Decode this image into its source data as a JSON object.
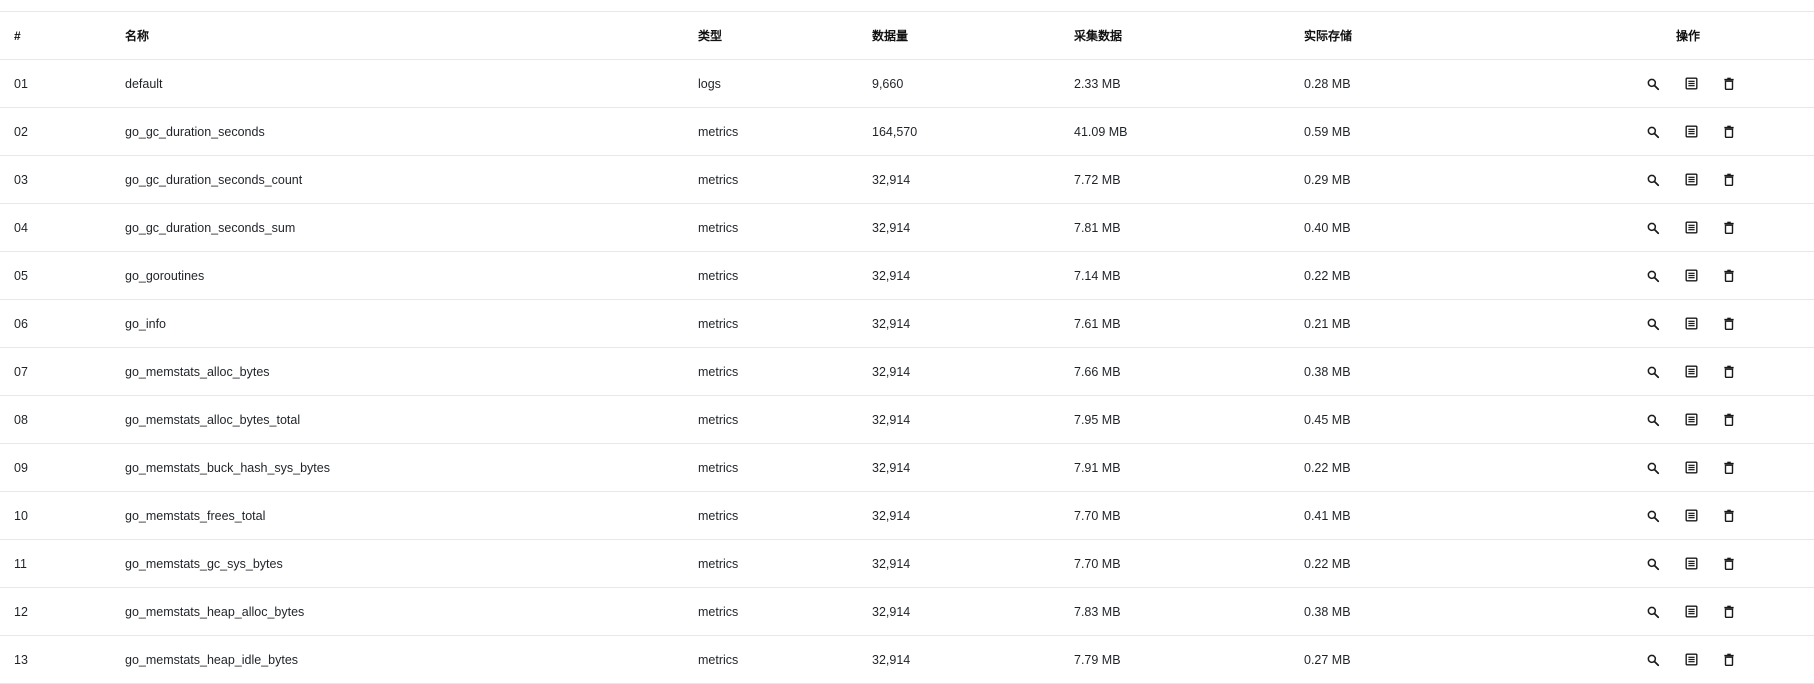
{
  "table": {
    "columns": {
      "index": "#",
      "name": "名称",
      "type": "类型",
      "count": "数据量",
      "collected": "采集数据",
      "storage": "实际存储",
      "actions": "操作"
    },
    "rows": [
      {
        "index": "01",
        "name": "default",
        "type": "logs",
        "count": "9,660",
        "collected": "2.33 MB",
        "storage": "0.28 MB"
      },
      {
        "index": "02",
        "name": "go_gc_duration_seconds",
        "type": "metrics",
        "count": "164,570",
        "collected": "41.09 MB",
        "storage": "0.59 MB"
      },
      {
        "index": "03",
        "name": "go_gc_duration_seconds_count",
        "type": "metrics",
        "count": "32,914",
        "collected": "7.72 MB",
        "storage": "0.29 MB"
      },
      {
        "index": "04",
        "name": "go_gc_duration_seconds_sum",
        "type": "metrics",
        "count": "32,914",
        "collected": "7.81 MB",
        "storage": "0.40 MB"
      },
      {
        "index": "05",
        "name": "go_goroutines",
        "type": "metrics",
        "count": "32,914",
        "collected": "7.14 MB",
        "storage": "0.22 MB"
      },
      {
        "index": "06",
        "name": "go_info",
        "type": "metrics",
        "count": "32,914",
        "collected": "7.61 MB",
        "storage": "0.21 MB"
      },
      {
        "index": "07",
        "name": "go_memstats_alloc_bytes",
        "type": "metrics",
        "count": "32,914",
        "collected": "7.66 MB",
        "storage": "0.38 MB"
      },
      {
        "index": "08",
        "name": "go_memstats_alloc_bytes_total",
        "type": "metrics",
        "count": "32,914",
        "collected": "7.95 MB",
        "storage": "0.45 MB"
      },
      {
        "index": "09",
        "name": "go_memstats_buck_hash_sys_bytes",
        "type": "metrics",
        "count": "32,914",
        "collected": "7.91 MB",
        "storage": "0.22 MB"
      },
      {
        "index": "10",
        "name": "go_memstats_frees_total",
        "type": "metrics",
        "count": "32,914",
        "collected": "7.70 MB",
        "storage": "0.41 MB"
      },
      {
        "index": "11",
        "name": "go_memstats_gc_sys_bytes",
        "type": "metrics",
        "count": "32,914",
        "collected": "7.70 MB",
        "storage": "0.22 MB"
      },
      {
        "index": "12",
        "name": "go_memstats_heap_alloc_bytes",
        "type": "metrics",
        "count": "32,914",
        "collected": "7.83 MB",
        "storage": "0.38 MB"
      },
      {
        "index": "13",
        "name": "go_memstats_heap_idle_bytes",
        "type": "metrics",
        "count": "32,914",
        "collected": "7.79 MB",
        "storage": "0.27 MB"
      }
    ],
    "action_icons": [
      "search-icon",
      "schema-icon",
      "delete-icon"
    ]
  },
  "colors": {
    "text": "#1f2328",
    "border": "#e6e8eb",
    "icon": "#1a1a1a"
  }
}
